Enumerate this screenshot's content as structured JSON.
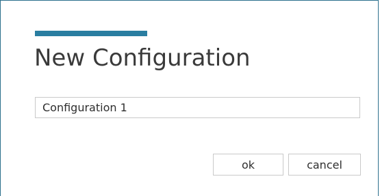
{
  "dialog": {
    "title": "New Configuration",
    "accent_color": "#2a7ea1",
    "name_field": {
      "value": "Configuration 1"
    },
    "buttons": {
      "ok_label": "ok",
      "cancel_label": "cancel"
    }
  }
}
